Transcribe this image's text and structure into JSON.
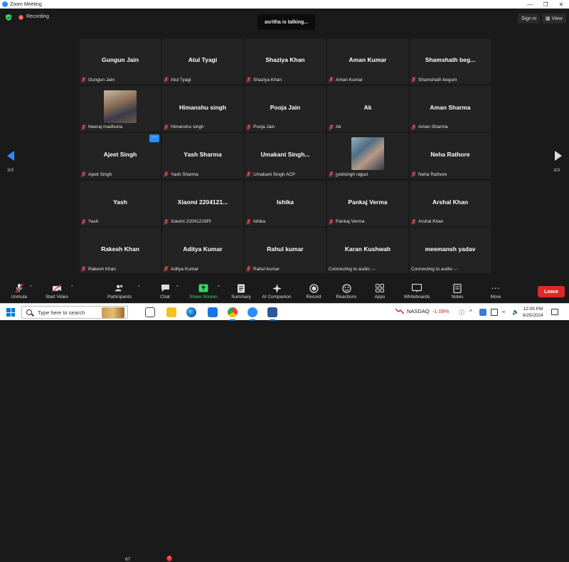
{
  "window": {
    "title": "Zoom Meeting"
  },
  "topbar": {
    "recording_label": "Recording",
    "talking": "asritha is talking...",
    "sign_in": "Sign in",
    "view": "View"
  },
  "participants": [
    {
      "display": "Gungun Jain",
      "label": "Gungun Jain"
    },
    {
      "display": "Atul Tyagi",
      "label": "Atul Tyagi"
    },
    {
      "display": "Shaziya Khan",
      "label": "Shaziya Khan"
    },
    {
      "display": "Aman Kumar",
      "label": "Aman Kumar"
    },
    {
      "display": "Shamshath  beg...",
      "label": "Shamshath begum"
    },
    {
      "display": "",
      "label": "Neeraj madhuria",
      "photo": true
    },
    {
      "display": "Himanshu singh",
      "label": "Himanshu singh"
    },
    {
      "display": "Pooja Jain",
      "label": "Pooja Jain"
    },
    {
      "display": "Ak",
      "label": "Ak"
    },
    {
      "display": "Aman Sharma",
      "label": "Aman Sharma"
    },
    {
      "display": "Ajeet Singh",
      "label": "Ajeet Singh",
      "more": "···"
    },
    {
      "display": "Yash Sharma",
      "label": "Yash Sharma"
    },
    {
      "display": "Umakant  Singh...",
      "label": "Umakant Singh ACP"
    },
    {
      "display": "",
      "label": "jyotisingh rajput",
      "photo": true
    },
    {
      "display": "Neha Rathore",
      "label": "Neha Rathore"
    },
    {
      "display": "Yash",
      "label": "Yash"
    },
    {
      "display": "Xiaomi 2204121...",
      "label": "Xiaomi 22041219PI"
    },
    {
      "display": "Ishika",
      "label": "Ishika"
    },
    {
      "display": "Pankaj Verma",
      "label": "Pankaj Verma"
    },
    {
      "display": "Arshal Khan",
      "label": "Arshal Khan"
    },
    {
      "display": "Rakesh Khan",
      "label": "Rakesh Khan"
    },
    {
      "display": "Aditya Kumar",
      "label": "Aditya Kumar"
    },
    {
      "display": "Rahul kumar",
      "label": "Rahul kumar"
    },
    {
      "display": "Karan Kushwah",
      "label": "Connecting to audio -.-",
      "connecting": true
    },
    {
      "display": "meemansh yadav",
      "label": "Connecting to audio -.-",
      "connecting": true
    }
  ],
  "paging": {
    "left": "3/3",
    "right": "3/3"
  },
  "toolbar": {
    "unmute": "Unmute",
    "start_video": "Start Video",
    "participants": "Participants",
    "participants_count": "67",
    "chat": "Chat",
    "chat_badge": "3",
    "share_screen": "Share Screen",
    "summary": "Summary",
    "ai_companion": "AI Companion",
    "record": "Record",
    "reactions": "Reactions",
    "apps": "Apps",
    "whiteboards": "Whiteboards",
    "notes": "Notes",
    "more": "More",
    "leave": "Leave"
  },
  "taskbar": {
    "search_placeholder": "Type here to search",
    "nasdaq_label": "NASDAQ",
    "nasdaq_change": "-1.09%",
    "time": "12:05 PM",
    "date": "6/25/2024"
  },
  "colors": {
    "zoom_blue": "#2d8cff",
    "leave_red": "#e02828",
    "share_green": "#3dd66a",
    "mic_red": "#e34b4b"
  }
}
